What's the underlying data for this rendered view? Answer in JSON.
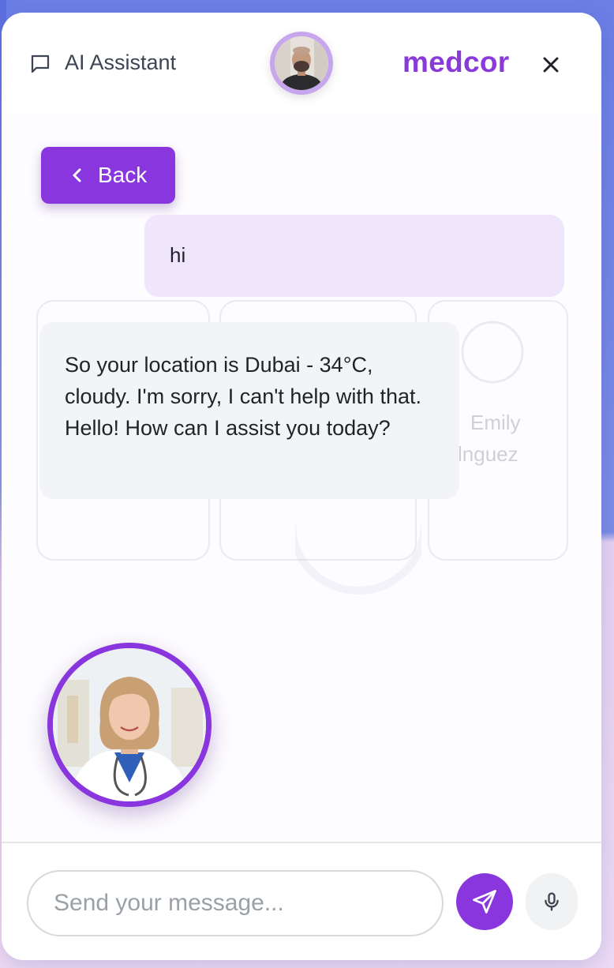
{
  "header": {
    "title": "AI Assistant",
    "brand": "medcor",
    "chat_icon": "chat-bubble-icon",
    "close_icon": "close-icon"
  },
  "nav": {
    "back_label": "Back"
  },
  "messages": [
    {
      "role": "user",
      "text": "hi"
    },
    {
      "role": "assistant",
      "text": "So your location is Dubai - 34°C, cloudy. I'm sorry, I can't help with that. Hello! How can I assist you today?"
    }
  ],
  "background_ghost": {
    "name_line1": "Emily",
    "name_line2": "lnguez"
  },
  "composer": {
    "placeholder": "Send your message...",
    "value": "",
    "send_icon": "send-icon",
    "mic_icon": "microphone-icon"
  },
  "colors": {
    "accent": "#8a36de",
    "brand": "#8a3ad9",
    "user_bubble": "#f0e6fc",
    "assistant_bubble": "#f3f4f6"
  }
}
